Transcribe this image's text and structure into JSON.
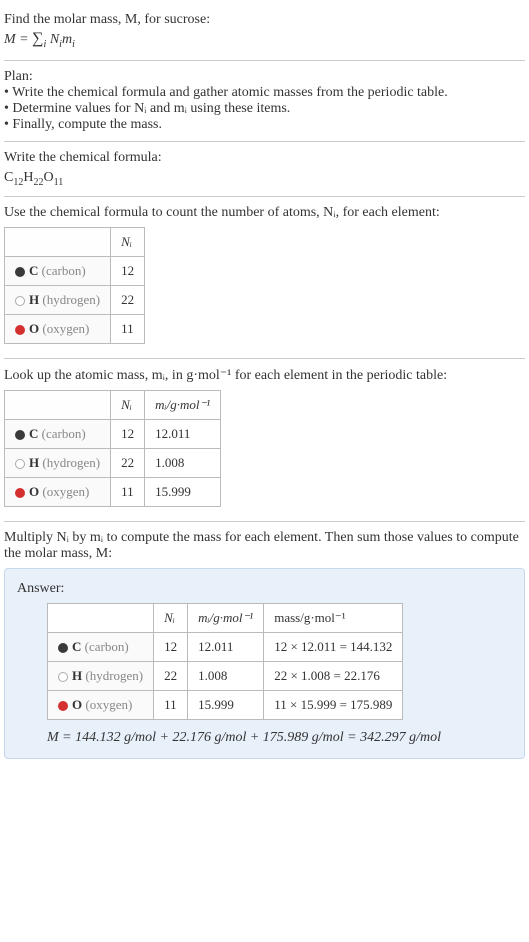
{
  "intro": {
    "line1": "Find the molar mass, M, for sucrose:",
    "formula": "M = ∑ Nᵢmᵢ",
    "formula_sub": "i"
  },
  "plan": {
    "heading": "Plan:",
    "item1": "• Write the chemical formula and gather atomic masses from the periodic table.",
    "item2": "• Determine values for Nᵢ and mᵢ using these items.",
    "item3": "• Finally, compute the mass."
  },
  "formula_section": {
    "heading": "Write the chemical formula:",
    "formula_base": "C",
    "c_sub": "12",
    "h": "H",
    "h_sub": "22",
    "o": "O",
    "o_sub": "11"
  },
  "count_section": {
    "heading": "Use the chemical formula to count the number of atoms, Nᵢ, for each element:",
    "col_ni": "Nᵢ",
    "rows": [
      {
        "sym": "C",
        "name": "(carbon)",
        "ni": "12",
        "marker": "carbon"
      },
      {
        "sym": "H",
        "name": "(hydrogen)",
        "ni": "22",
        "marker": "hydrogen"
      },
      {
        "sym": "O",
        "name": "(oxygen)",
        "ni": "11",
        "marker": "oxygen"
      }
    ]
  },
  "mass_section": {
    "heading": "Look up the atomic mass, mᵢ, in g·mol⁻¹ for each element in the periodic table:",
    "col_ni": "Nᵢ",
    "col_mi": "mᵢ/g·mol⁻¹",
    "rows": [
      {
        "sym": "C",
        "name": "(carbon)",
        "ni": "12",
        "mi": "12.011",
        "marker": "carbon"
      },
      {
        "sym": "H",
        "name": "(hydrogen)",
        "ni": "22",
        "mi": "1.008",
        "marker": "hydrogen"
      },
      {
        "sym": "O",
        "name": "(oxygen)",
        "ni": "11",
        "mi": "15.999",
        "marker": "oxygen"
      }
    ]
  },
  "multiply_section": {
    "heading": "Multiply Nᵢ by mᵢ to compute the mass for each element. Then sum those values to compute the molar mass, M:"
  },
  "answer": {
    "label": "Answer:",
    "col_ni": "Nᵢ",
    "col_mi": "mᵢ/g·mol⁻¹",
    "col_mass": "mass/g·mol⁻¹",
    "rows": [
      {
        "sym": "C",
        "name": "(carbon)",
        "ni": "12",
        "mi": "12.011",
        "mass": "12 × 12.011 = 144.132",
        "marker": "carbon"
      },
      {
        "sym": "H",
        "name": "(hydrogen)",
        "ni": "22",
        "mi": "1.008",
        "mass": "22 × 1.008 = 22.176",
        "marker": "hydrogen"
      },
      {
        "sym": "O",
        "name": "(oxygen)",
        "ni": "11",
        "mi": "15.999",
        "mass": "11 × 15.999 = 175.989",
        "marker": "oxygen"
      }
    ],
    "final": "M = 144.132 g/mol + 22.176 g/mol + 175.989 g/mol = 342.297 g/mol"
  }
}
